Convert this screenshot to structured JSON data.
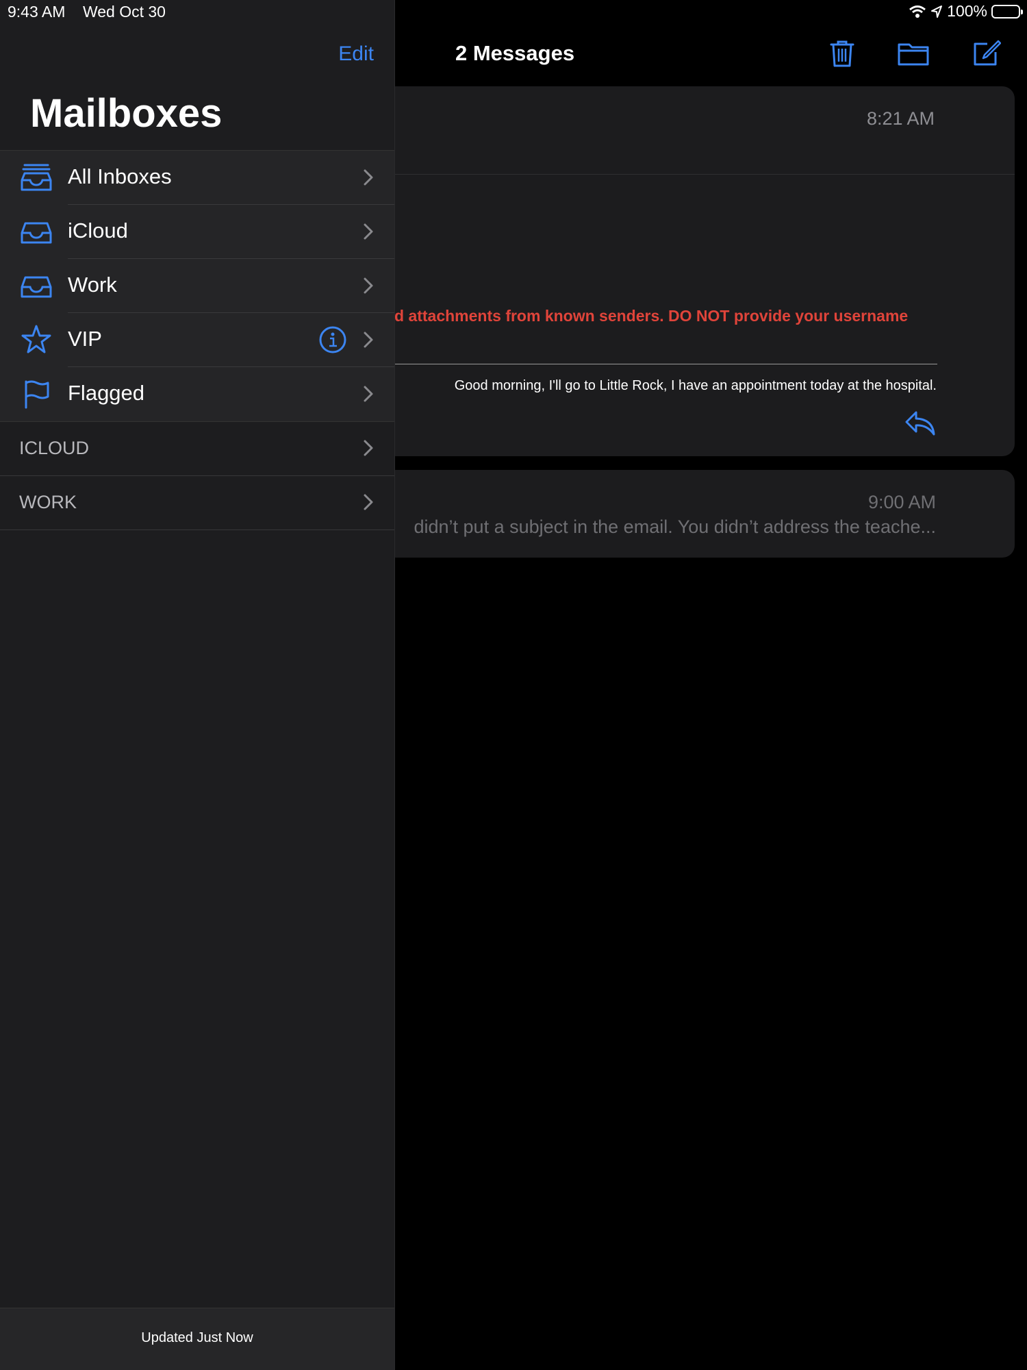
{
  "status_bar": {
    "time": "9:43 AM",
    "date": "Wed Oct 30",
    "battery": "100%",
    "icons": [
      "wifi-icon",
      "location-icon",
      "battery-icon"
    ]
  },
  "sidebar": {
    "edit_label": "Edit",
    "title": "Mailboxes",
    "mailboxes": [
      {
        "label": "All Inboxes",
        "icon": "all-inboxes-icon"
      },
      {
        "label": "iCloud",
        "icon": "inbox-tray-icon"
      },
      {
        "label": "Work",
        "icon": "inbox-tray-icon"
      },
      {
        "label": "VIP",
        "icon": "star-icon"
      },
      {
        "label": "Flagged",
        "icon": "flag-icon"
      }
    ],
    "accounts": [
      {
        "label": "ICLOUD"
      },
      {
        "label": "WORK"
      }
    ],
    "footer": "Updated Just Now"
  },
  "message_list": {
    "title": "2 Messages",
    "toolbar_icons": [
      "trash-icon",
      "folder-icon",
      "compose-icon"
    ],
    "messages": [
      {
        "time": "8:21 AM",
        "warning": "d attachments from known senders. DO NOT provide your username",
        "body": "Good morning, I'll go to Little Rock, I have an appointment today at the hospital."
      },
      {
        "time": "9:00 AM",
        "preview": "didn’t put a subject in the email. You didn’t address the teache..."
      }
    ]
  },
  "colors": {
    "accent": "#3c85f1",
    "warning": "#e0443a",
    "sidebar_bg": "#1d1d1f",
    "card_bg": "#1c1c1e"
  }
}
